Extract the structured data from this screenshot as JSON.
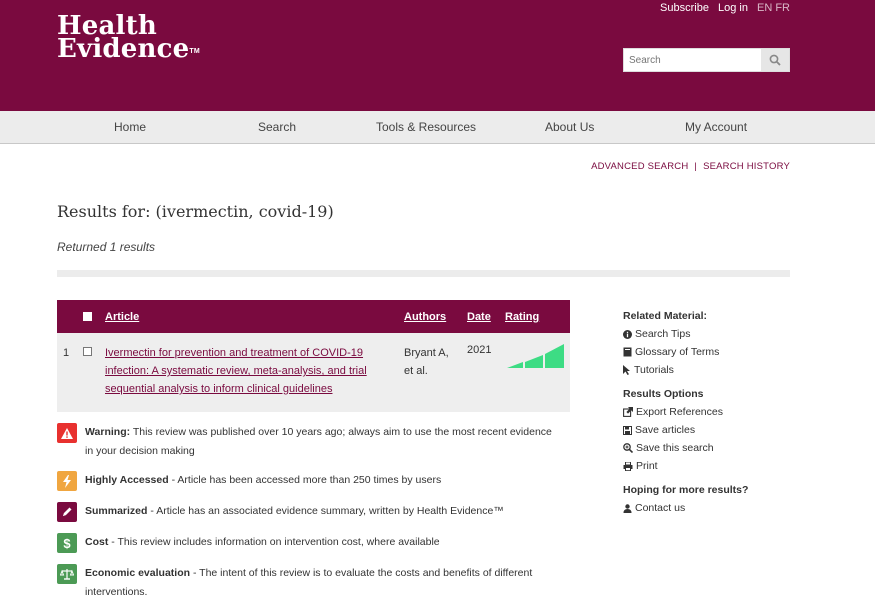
{
  "header": {
    "logo_line1": "Health",
    "logo_line2": "Evidence",
    "logo_tm": "TM",
    "subscribe": "Subscribe",
    "login": "Log in",
    "lang_en": "EN",
    "lang_fr": "FR",
    "search_placeholder": "Search",
    "brand_color": "#7a0a3f"
  },
  "nav": {
    "home": "Home",
    "search": "Search",
    "tools": "Tools & Resources",
    "about": "About Us",
    "account": "My Account"
  },
  "links": {
    "advanced_search": "ADVANCED SEARCH",
    "separator": "|",
    "search_history": "SEARCH HISTORY"
  },
  "results": {
    "title": "Results for: (ivermectin, covid-19)",
    "returned": "Returned 1 results"
  },
  "table": {
    "headers": {
      "article": "Article",
      "authors": "Authors",
      "date": "Date",
      "rating": "Rating"
    },
    "rows": [
      {
        "num": "1",
        "title": "Ivermectin for prevention and treatment of COVID-19 infection: A systematic review, meta-analysis, and trial sequential analysis to inform clinical guidelines",
        "authors": "Bryant A, et al.",
        "date": "2021",
        "rating_color": "#3ddc84"
      }
    ]
  },
  "legend": [
    {
      "icon": "warning-icon",
      "color": "#e8312f",
      "label": "Warning:",
      "text": " This review was published over 10 years ago; always aim to use the most recent evidence in your decision making"
    },
    {
      "icon": "lightning-icon",
      "color": "#f0a640",
      "label": "Highly Accessed",
      "text": " - Article has been accessed more than 250 times by users"
    },
    {
      "icon": "pencil-icon",
      "color": "#7a0a3f",
      "label": "Summarized",
      "text": " - Article has an associated evidence summary, written by Health Evidence™"
    },
    {
      "icon": "dollar-icon",
      "color": "#4c9a55",
      "label": "Cost",
      "text": " - This review includes information on intervention cost, where available"
    },
    {
      "icon": "scales-icon",
      "color": "#4c9a55",
      "label": "Economic evaluation",
      "text": " - The intent of this review is to evaluate the costs and benefits of different interventions."
    }
  ],
  "sidebar": {
    "related_heading": "Related Material:",
    "search_tips": "Search Tips",
    "glossary": "Glossary of Terms",
    "tutorials": "Tutorials",
    "options_heading": "Results Options",
    "export": "Export References",
    "save_articles": "Save articles",
    "save_search": "Save this search",
    "print": "Print",
    "more_heading": "Hoping for more results?",
    "contact": "Contact us"
  }
}
